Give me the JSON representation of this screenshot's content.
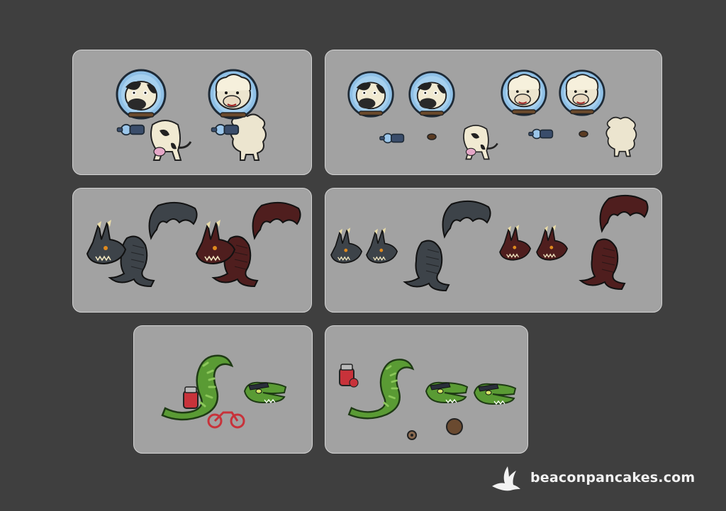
{
  "brand": {
    "site": "beaconpancakes.com",
    "logo_icon": "bird-icon"
  },
  "colors": {
    "background": "#3f3f3f",
    "panel": "#a2a2a2",
    "panel_border": "#d4d4d4",
    "cow": "#f1ead2",
    "sheep": "#ece5cf",
    "helmet": "#8fc0e6",
    "dark_dragon": "#3d4349",
    "red_dragon": "#4f1e1e",
    "croc": "#5a9b34",
    "bike": "#c8323a"
  },
  "panels": [
    {
      "name": "astronaut-animals-assembled",
      "characters": [
        "cow",
        "sheep"
      ]
    },
    {
      "name": "astronaut-animals-parts",
      "characters": [
        "cow",
        "sheep"
      ]
    },
    {
      "name": "dragons-assembled",
      "characters": [
        "dark-dragon",
        "red-dragon"
      ]
    },
    {
      "name": "dragons-parts",
      "characters": [
        "dark-dragon",
        "red-dragon"
      ]
    },
    {
      "name": "croc-biker-assembled",
      "characters": [
        "crocodile"
      ]
    },
    {
      "name": "croc-biker-parts",
      "characters": [
        "crocodile"
      ]
    }
  ]
}
